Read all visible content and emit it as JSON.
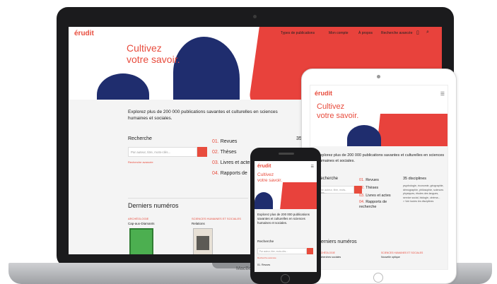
{
  "brand": {
    "logo": "érudit",
    "accent": "#e84c3d",
    "navy": "#1f2d6e"
  },
  "laptop": {
    "nav": [
      "Types de publications",
      "Mon compte",
      "À propos",
      "Recherche avancée"
    ],
    "tagline": "Cultivez\nvotre savoir.",
    "explore": "Explorez plus de 200 000 publications savantes et culturelles en sciences humaines et sociales.",
    "search_label": "Recherche",
    "search_placeholder": "Par auteur, titre, mots-clés...",
    "advanced_link": "Recherche avancée",
    "list": [
      {
        "num": "01.",
        "label": "Revues"
      },
      {
        "num": "02.",
        "label": "Thèses"
      },
      {
        "num": "03.",
        "label": "Livres et actes"
      },
      {
        "num": "04.",
        "label": "Rapports de"
      }
    ],
    "disciplines_partial": "35",
    "derniers": "Derniers numéros",
    "cards": [
      {
        "category": "ARCHÉOLOGIE",
        "title": "Cap-aux-Diamants"
      },
      {
        "category": "SCIENCES HUMAINES ET SOCIALES",
        "title": "Relations"
      }
    ],
    "device_brand": "MacBook"
  },
  "tablet": {
    "tagline": "Cultivez\nvotre savoir.",
    "explore": "Explorez plus de 200 000 publications savantes et culturelles en sciences humaines et sociales.",
    "search_label": "Recherche",
    "search_placeholder": "Par auteur, titre, mots-clés...",
    "list": [
      {
        "num": "01.",
        "label": "Revues"
      },
      {
        "num": "02.",
        "label": "Thèses"
      },
      {
        "num": "03.",
        "label": "Livres et actes"
      },
      {
        "num": "04.",
        "label": "Rapports de recherche"
      }
    ],
    "disciplines": "35 disciplines",
    "disciplines_list": "psychologie, économie, géographie, démographie, philosophie, sciences physiques, études des langues, service social, biologie, cinéma...",
    "disciplines_more": "> Voir toutes les disciplines",
    "derniers": "Derniers numéros",
    "cards": [
      {
        "category": "ARCHÉOLOGIE",
        "title": "Recherches sociales"
      },
      {
        "category": "SCIENCES HUMAINES ET SOCIALES",
        "title": "Nouvelle optique"
      }
    ]
  },
  "phone": {
    "tagline": "Cultivez\nvotre savoir.",
    "explore": "Explorez plus de 200 000 publications savantes et culturelles en sciences humaines et sociales.",
    "search_label": "Recherche",
    "search_placeholder": "Par auteur, titre, mots-clés...",
    "advanced_link": "Recherche avancée",
    "bottom": "01. Revues"
  }
}
